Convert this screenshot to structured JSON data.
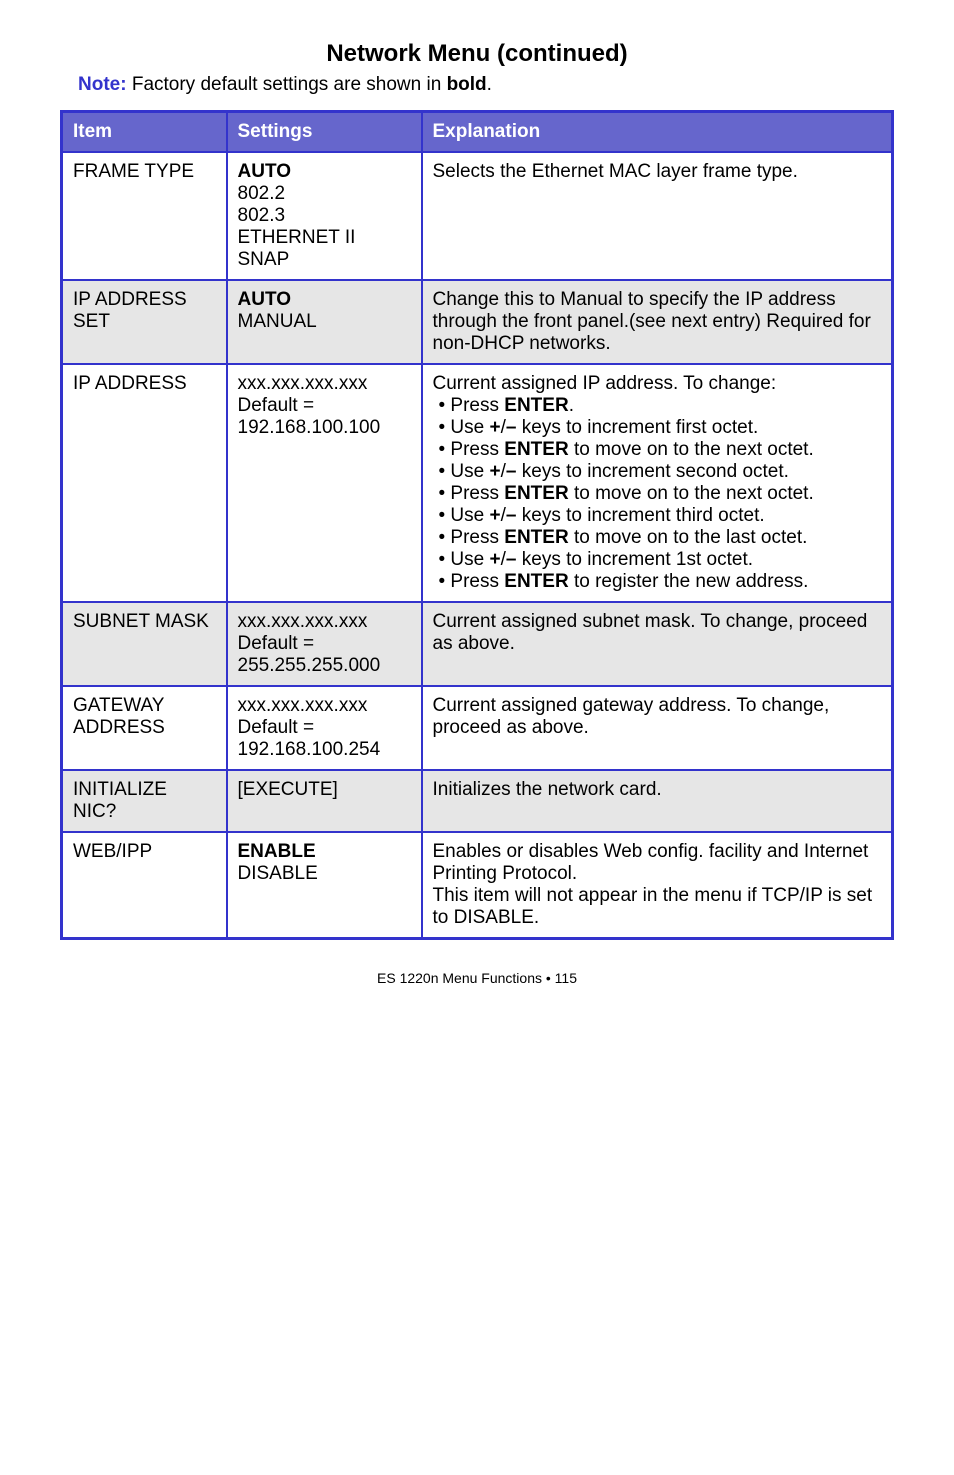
{
  "title": "Network Menu (continued)",
  "note": {
    "label": "Note:",
    "prefix": " Factory default settings are shown in ",
    "bold": "bold",
    "suffix": "."
  },
  "headers": {
    "item": "Item",
    "settings": "Settings",
    "explanation": "Explanation"
  },
  "rows": {
    "frame_type": {
      "item": "FRAME TYPE",
      "s1": "AUTO",
      "s2": "802.2",
      "s3": "802.3",
      "s4": "ETHERNET II",
      "s5": "SNAP",
      "exp": "Selects the Ethernet MAC layer frame type."
    },
    "ip_set": {
      "item": "IP ADDRESS SET",
      "s1": "AUTO",
      "s2": "MANUAL",
      "exp": "Change this to Manual to specify the IP address through the front panel.(see next entry) Required for non-DHCP networks."
    },
    "ip_addr": {
      "item": "IP ADDRESS",
      "s1": "xxx.xxx.xxx.xxx",
      "s2": "Default =",
      "s3": "192.168.100.100",
      "e1": "Current assigned IP address. To change:",
      "e2a": "• Press ",
      "e2b": "ENTER",
      "e2c": ".",
      "e3a": "• Use ",
      "e3b": "+",
      "e3c": "/",
      "e3d": "–",
      "e3e": " keys to increment first octet.",
      "e4a": "• Press ",
      "e4b": "ENTER",
      "e4c": "  to move on to the next octet.",
      "e5a": "• Use ",
      "e5b": "+",
      "e5c": "/",
      "e5d": "–",
      "e5e": " keys to increment second octet.",
      "e6a": "• Press ",
      "e6b": "ENTER",
      "e6c": "  to move on to the next octet.",
      "e7a": "• Use ",
      "e7b": "+",
      "e7c": "/",
      "e7d": "–",
      "e7e": " keys to increment third octet.",
      "e8a": "• Press ",
      "e8b": "ENTER",
      "e8c": "  to move on to the last octet.",
      "e9a": "• Use ",
      "e9b": "+",
      "e9c": "/",
      "e9d": "–",
      "e9e": " keys to increment 1st octet.",
      "e10a": "• Press ",
      "e10b": "ENTER",
      "e10c": " to register the new address."
    },
    "subnet": {
      "item": "SUBNET MASK",
      "s1": "xxx.xxx.xxx.xxx",
      "s2": "Default =",
      "s3": "255.255.255.000",
      "exp": "Current assigned subnet mask. To change, proceed as above."
    },
    "gateway": {
      "item": "GATEWAY ADDRESS",
      "s1": "xxx.xxx.xxx.xxx",
      "s2": "Default =",
      "s3": "192.168.100.254",
      "exp": "Current assigned gateway address. To change, proceed as above."
    },
    "init": {
      "item": "INITIALIZE NIC?",
      "s1": "[EXECUTE]",
      "exp": "Initializes the network card."
    },
    "web": {
      "item": "WEB/IPP",
      "s1": "ENABLE",
      "s2": "DISABLE",
      "e1": "Enables or disables Web config. facility and Internet Printing Protocol.",
      "e2": "This item will not appear in the menu if TCP/IP is set to DISABLE."
    }
  },
  "footer": "ES 1220n Menu Functions  •  115"
}
